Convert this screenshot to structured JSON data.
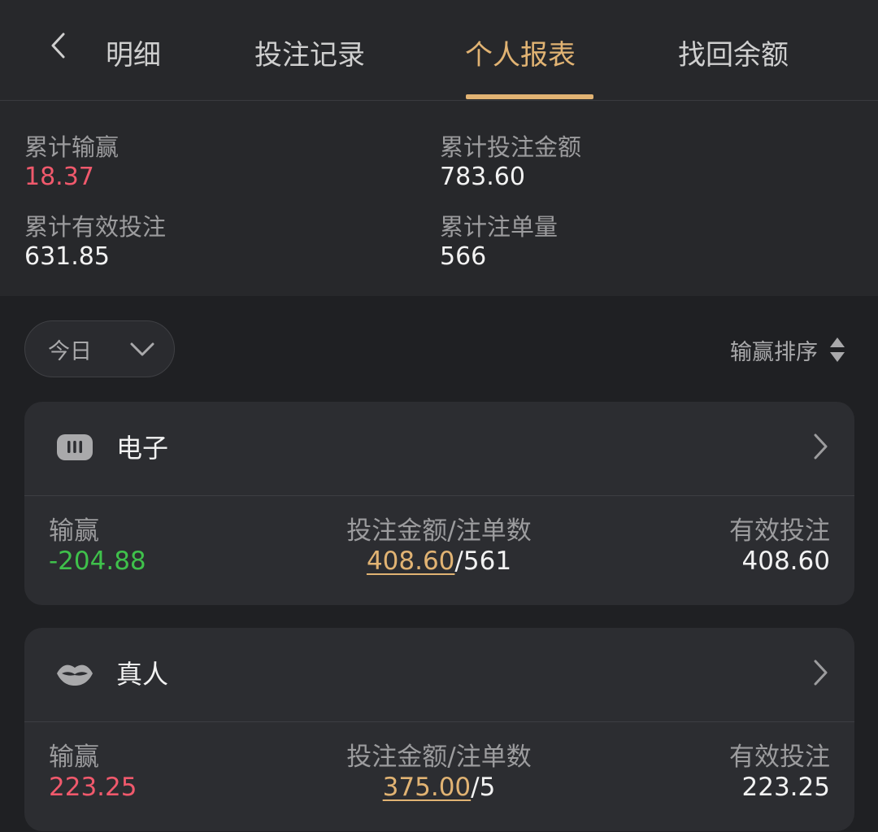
{
  "header": {
    "tabs": [
      {
        "label": "明细",
        "active": false
      },
      {
        "label": "投注记录",
        "active": false
      },
      {
        "label": "个人报表",
        "active": true
      },
      {
        "label": "找回余额",
        "active": false
      }
    ],
    "back_icon": "chevron-left-icon"
  },
  "summary": {
    "total_winloss_label": "累计输赢",
    "total_winloss_value": "18.37",
    "total_bet_label": "累计投注金额",
    "total_bet_value": "783.60",
    "total_valid_label": "累计有效投注",
    "total_valid_value": "631.85",
    "total_orders_label": "累计注单量",
    "total_orders_value": "566"
  },
  "filter": {
    "date_value": "今日",
    "sort_label": "输赢排序"
  },
  "cards": [
    {
      "title": "电子",
      "icon": "slot-machine-icon",
      "winloss_label": "输赢",
      "winloss_value": "-204.88",
      "bet_label": "投注金额/注单数",
      "bet_amount": "408.60",
      "bet_count": "/561",
      "valid_label": "有效投注",
      "valid_value": "408.60"
    },
    {
      "title": "真人",
      "icon": "lips-icon",
      "winloss_label": "输赢",
      "winloss_value": "223.25",
      "bet_label": "投注金额/注单数",
      "bet_amount": "375.00",
      "bet_count": "/5",
      "valid_label": "有效投注",
      "valid_value": "223.25"
    }
  ],
  "colors": {
    "accent": "#e1b373",
    "positive": "#f0596c",
    "negative": "#3fc14b",
    "background": "#1f2023",
    "panel": "#27282b",
    "card": "#2c2d31"
  }
}
